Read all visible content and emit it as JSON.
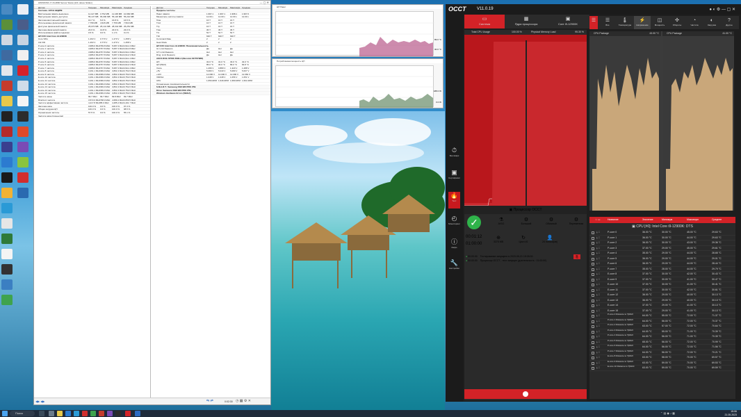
{
  "hwinfo": {
    "title": "HWiNFO64 v7.16-4800 Sensor Status [121 values hidden]",
    "left_cols": [
      "Датчик",
      "Текущее",
      "Минимум",
      "Максимум",
      "Среднее"
    ],
    "right_cols": [
      "Датчик",
      "Текущее",
      "Минимум",
      "Максимум",
      "Среднее"
    ],
    "left_rows": [
      {
        "n": "Системн. АРСН НКДРМ",
        "c": "",
        "mn": "",
        "mx": "",
        "av": "",
        "g": true
      },
      {
        "n": "Виртуальная память выделено",
        "c": "11,127 MB",
        "mn": "3,752 MB",
        "mx": "11,168 MB",
        "av": "10,984 MB"
      },
      {
        "n": "Виртуальная память доступно",
        "c": "55,147 MB",
        "mn": "65,090 MB",
        "mx": "55,118 MB",
        "av": "55,210 MB"
      },
      {
        "n": "Загрузка виртуальной памяти",
        "c": "16.7 %",
        "mn": "5.6 %",
        "mx": "16.8 %",
        "av": "16.5 %"
      },
      {
        "n": "Использовано физической памяти",
        "c": "7,758 MB",
        "mn": "4,526 MB",
        "mx": "7,756 MB",
        "av": "7,563 MB"
      },
      {
        "n": "Доступно физической памяти",
        "c": "25,073 MB",
        "mn": "25,141 MB",
        "mx": "28,344 MB",
        "av": "25,251 MB"
      },
      {
        "n": "Загрузка физической памяти",
        "c": "23.6 %",
        "mn": "13.8 %",
        "mx": "23.9 %",
        "av": "23.0 %"
      },
      {
        "n": "Использование файла подкачки",
        "c": "0.5 %",
        "mn": "0.0 %",
        "mx": "1.1 %",
        "av": "0.4 %"
      },
      {
        "n": "ЦП [#0]: Intel Core i9-12900K",
        "c": "",
        "mn": "",
        "mx": "",
        "av": "",
        "g": true
      },
      {
        "n": "Core VIDs",
        "c": "1.263 V",
        "mn": "0.770 V",
        "mx": "1.270 V",
        "av": "1.258 V"
      },
      {
        "n": "Clk VID",
        "c": "1.263 V",
        "mn": "0.770 V",
        "mx": "1.270 V",
        "av": "1.258 V"
      },
      {
        "n": "P-core 0 частота",
        "c": "4,986.0 MHz",
        "mn": "799.8 MHz",
        "mx": "5,087.3 MHz",
        "av": "4,911.3 MHz"
      },
      {
        "n": "P-core 1 частота",
        "c": "4,986.0 MHz",
        "mn": "797.8 MHz",
        "mx": "5,087.3 MHz",
        "av": "4,911.8 MHz"
      },
      {
        "n": "P-core 2 частота",
        "c": "4,986.0 MHz",
        "mn": "797.8 MHz",
        "mx": "5,087.3 MHz",
        "av": "4,911.3 MHz"
      },
      {
        "n": "P-core 3 частота",
        "c": "4,986.0 MHz",
        "mn": "797.8 MHz",
        "mx": "5,087.3 MHz",
        "av": "4,912.3 MHz"
      },
      {
        "n": "P-core 4 частота",
        "c": "4,986.0 MHz",
        "mn": "797.8 MHz",
        "mx": "5,087.3 MHz",
        "av": "4,911.4 MHz"
      },
      {
        "n": "P-core 5 частота",
        "c": "4,986.0 MHz",
        "mn": "797.8 MHz",
        "mx": "5,087.3 MHz",
        "av": "4,911.4 MHz"
      },
      {
        "n": "P-core 6 частота",
        "c": "4,986.0 MHz",
        "mn": "797.8 MHz",
        "mx": "5,087.3 MHz",
        "av": "4,912.3 MHz"
      },
      {
        "n": "P-core 7 частота",
        "c": "4,986.0 MHz",
        "mn": "797.8 MHz",
        "mx": "5,087.3 MHz",
        "av": "4,911.4 MHz"
      },
      {
        "n": "E-core 8 частота",
        "c": "3,461.1 MHz",
        "mn": "399.9 MHz",
        "mx": "3,891.9 MHz",
        "av": "3,752.6 MHz"
      },
      {
        "n": "E-core 9 частота",
        "c": "3,461.1 MHz",
        "mn": "399.9 MHz",
        "mx": "3,891.9 MHz",
        "av": "3,752.6 MHz"
      },
      {
        "n": "E-core 10 частота",
        "c": "3,461.1 MHz",
        "mn": "399.9 MHz",
        "mx": "3,891.9 MHz",
        "av": "3,752.6 MHz"
      },
      {
        "n": "E-core 11 частота",
        "c": "3,461.1 MHz",
        "mn": "399.9 MHz",
        "mx": "3,891.9 MHz",
        "av": "3,752.6 MHz"
      },
      {
        "n": "E-core 12 частота",
        "c": "3,461.1 MHz",
        "mn": "399.9 MHz",
        "mx": "3,891.9 MHz",
        "av": "3,752.6 MHz"
      },
      {
        "n": "E-core 13 частота",
        "c": "3,461.1 MHz",
        "mn": "399.9 MHz",
        "mx": "3,891.9 MHz",
        "av": "3,752.6 MHz"
      },
      {
        "n": "E-core 14 частота",
        "c": "3,461.1 MHz",
        "mn": "399.9 MHz",
        "mx": "3,891.9 MHz",
        "av": "3,752.6 MHz"
      },
      {
        "n": "E-core 15 частота",
        "c": "3,461.1 MHz",
        "mn": "399.9 MHz",
        "mx": "3,891.9 MHz",
        "av": "3,752.6 MHz"
      },
      {
        "n": "Частота шины",
        "c": "99.7 MHz",
        "mn": "99.7 MHz",
        "mx": "99.8 MHz",
        "av": "99.7 MHz"
      },
      {
        "n": "Ring/LLC частота",
        "c": "3,572.0 MHz",
        "mn": "798.0 MHz",
        "mx": "4,689.4 MHz",
        "av": "3,650.5 MHz"
      },
      {
        "n": "Частота эффективная частота",
        "c": "4,217.8 MHz",
        "mn": "85.0 MHz",
        "mx": "4,285.4 MHz",
        "av": "4,191.7 MHz"
      },
      {
        "n": "Загрузка ядра",
        "c": "100.0 %",
        "mn": "0.0 %",
        "mx": "100.0 %",
        "av": "97.3 %"
      },
      {
        "n": "Общая загрузка ЦП",
        "c": "100.0 %",
        "mn": "0.6 %",
        "mx": "100.0 %",
        "av": "98.5 %"
      },
      {
        "n": "Ограничения частоты",
        "c": "57.5 %",
        "mn": "0.0 %",
        "mx": "100.0 %",
        "av": "55.1 %"
      },
      {
        "n": "Частота ядра (процентов)",
        "c": "",
        "mn": "",
        "mx": "",
        "av": ""
      }
    ],
    "right_rows": [
      {
        "n": "Пределы частоты",
        "c": "",
        "mn": "",
        "mx": "",
        "av": "",
        "g": true
      },
      {
        "n": "Пакет памяти",
        "c": "1,997.1",
        "mn": "1,997.1",
        "mx": "1,998.1",
        "av": "1,997.6"
      },
      {
        "n": "Множитель частоты памяти",
        "c": "12.00 x",
        "mn": "12.00 x",
        "mx": "12.00 x",
        "av": "12.00 x"
      },
      {
        "n": "Tcas",
        "c": "16 T",
        "mn": "16 T",
        "mx": "16 T",
        "av": ""
      },
      {
        "n": "Trcd",
        "c": "16 T",
        "mn": "16 T",
        "mx": "16 T",
        "av": ""
      },
      {
        "n": "Trp",
        "c": "16 T",
        "mn": "16 T",
        "mx": "16 T",
        "av": ""
      },
      {
        "n": "Tras",
        "c": "36 T",
        "mn": "36 T",
        "mx": "36 T",
        "av": ""
      },
      {
        "n": "Trc",
        "c": "52 T",
        "mn": "52 T",
        "mx": "52 T",
        "av": ""
      },
      {
        "n": "Trfc",
        "c": "630 T",
        "mn": "630 T",
        "mx": "630 T",
        "av": ""
      },
      {
        "n": "Command Rate",
        "c": "2",
        "mn": "2",
        "mx": "2",
        "av": ""
      },
      {
        "n": "Gear Mode",
        "c": "2",
        "mn": "2",
        "mx": "2",
        "av": ""
      },
      {
        "n": "ЦП [#0]: Intel Core i9-12900K: Производительность",
        "c": "",
        "mn": "",
        "mx": "",
        "av": "",
        "g": true
      },
      {
        "n": "IA: Limit Reasons",
        "c": "Да",
        "mn": "Нет",
        "mx": "Да",
        "av": ""
      },
      {
        "n": "GT: Limit Reasons",
        "c": "Нет",
        "mn": "Нет",
        "mx": "Нет",
        "av": ""
      },
      {
        "n": "Ring: Limit Reasons",
        "c": "Да",
        "mn": "Нет",
        "mx": "Да",
        "av": ""
      },
      {
        "n": "ASUS ROG STRIX Z690-A (Nuvoton NCT6798D)",
        "c": "",
        "mn": "",
        "mx": "",
        "av": "",
        "g": true
      },
      {
        "n": "ЦП",
        "c": "32.0 °C",
        "mn": "31.0 °C",
        "mx": "33.0 °C",
        "av": "32.0 °C"
      },
      {
        "n": "ЦП (PECI)",
        "c": "85.0 °C",
        "mn": "30.0 °C",
        "mx": "89.0 °C",
        "av": "83.8 °C"
      },
      {
        "n": "Vcore",
        "c": "1.296 V",
        "mn": "0.880 V",
        "mx": "1.320 V",
        "av": "1.288 V"
      },
      {
        "n": "+5V",
        "c": "5.080 V",
        "mn": "5.040 V",
        "mx": "5.080 V",
        "av": "5.067 V"
      },
      {
        "n": "+12V",
        "c": "12.096 V",
        "mn": "12.000 V",
        "mx": "12.096 V",
        "av": "12.060 V"
      },
      {
        "n": "VDDSA",
        "c": "1.048 V",
        "mn": "1.048 V",
        "mx": "1.056 V",
        "av": "1.051 V"
      },
      {
        "n": "CPU",
        "c": "1,556 RPM",
        "mn": "1,546 RPM",
        "mx": "1,580 RPM",
        "av": "1,561 RPM"
      },
      {
        "n": "Ограничение производительности",
        "c": "",
        "mn": "",
        "mx": "",
        "av": ""
      },
      {
        "n": "S.M.A.R.T.: Samsung SSD 980 PRO 2TB",
        "c": "",
        "mn": "",
        "mx": "",
        "av": "",
        "g": true
      },
      {
        "n": "Drive: Samsung SSD 980 PRO 2TB",
        "c": "",
        "mn": "",
        "mx": "",
        "av": "",
        "g": true
      },
      {
        "n": "Windows Hardware Errors (WHEA)",
        "c": "",
        "mn": "",
        "mx": "",
        "av": "",
        "g": true
      }
    ],
    "status_time": "0:02:30"
  },
  "graph_windows": {
    "top_title": "ЦП Пакет",
    "bottom_title": "Потребляемая мощность ЦП",
    "top_max": "89.0 °C",
    "top_min": "30.0 °C",
    "bottom_max": "188.0 W",
    "bottom_min": "0.0 W"
  },
  "occt": {
    "logo": "OCCT",
    "version": "V11.0.19",
    "top_tabs": [
      "Система",
      "Ядра процессора",
      "Core i9-12900K"
    ],
    "left_panel": {
      "h1": "Total CPU Usage",
      "v1": "100.00 %",
      "h2": "Physical Memory Load",
      "v2": "95.30 %"
    },
    "side": [
      {
        "icon": "⏱",
        "label": "Бенчмарк"
      },
      {
        "icon": "▣",
        "label": "Сертификат"
      },
      {
        "icon": "🔥",
        "label": "Тест"
      },
      {
        "icon": "◴",
        "label": "Мониторинг"
      },
      {
        "icon": "ⓘ",
        "label": "Инфо"
      },
      {
        "icon": "🔧",
        "label": "Настройки"
      }
    ],
    "test": {
      "title": "Процессор OCCT",
      "modes": [
        "AVX2",
        "Большой",
        "Обычный",
        "Переменная"
      ],
      "elapsed": "00:01:12",
      "duration": "01:00:00",
      "stat1": "3375 MB",
      "stat2": "Цикл #1",
      "stat3": "24 потока(ов)",
      "log": [
        {
          "t": "00:00:00",
          "m": "Тестирование запущено в 2023-05-21 15:05:00"
        },
        {
          "t": "00:00:00",
          "m": "Процессор OCCT - тест запущен (длительность : 01:00:00)"
        }
      ]
    },
    "perf_tabs": [
      {
        "icon": "☰",
        "label": "Все"
      },
      {
        "icon": "🌡",
        "label": "Температура"
      },
      {
        "icon": "⚡",
        "label": "Напряжение"
      },
      {
        "icon": "◫",
        "label": "Мощность"
      },
      {
        "icon": "✣",
        "label": "Обороты"
      },
      {
        "icon": "◔",
        "label": "Частота"
      },
      {
        "icon": "◐",
        "label": "Загрузка"
      },
      {
        "icon": "?",
        "label": "Другое"
      }
    ],
    "perf_panels": [
      {
        "title": "CPU Package",
        "value": "43.00 °C"
      },
      {
        "title": "CPU Package",
        "value": "41.00 °C"
      }
    ],
    "sensor_header": [
      "Название",
      "Значение",
      "Минимум",
      "Максимум",
      "Среднее"
    ],
    "sensor_group": "CPU [#0]: Intel Core i9-12900K: DTS",
    "sensors": [
      {
        "n": "P-core 0",
        "v": "36.00 °C",
        "mn": "30.00 °C",
        "mx": "45.00 °C",
        "av": "29.63 °C"
      },
      {
        "n": "P-core 1",
        "v": "36.00 °C",
        "mn": "30.00 °C",
        "mx": "44.00 °C",
        "av": "29.63 °C"
      },
      {
        "n": "P-core 2",
        "v": "36.00 °C",
        "mn": "30.00 °C",
        "mx": "43.00 °C",
        "av": "29.36 °C"
      },
      {
        "n": "P-core 3",
        "v": "37.00 °C",
        "mn": "29.00 °C",
        "mx": "45.00 °C",
        "av": "29.61 °C"
      },
      {
        "n": "P-core 4",
        "v": "35.00 °C",
        "mn": "29.00 °C",
        "mx": "44.00 °C",
        "av": "28.65 °C"
      },
      {
        "n": "P-core 5",
        "v": "36.00 °C",
        "mn": "29.00 °C",
        "mx": "44.00 °C",
        "av": "29.01 °C"
      },
      {
        "n": "P-core 6",
        "v": "36.00 °C",
        "mn": "29.00 °C",
        "mx": "44.00 °C",
        "av": "28.44 °C"
      },
      {
        "n": "P-core 7",
        "v": "35.00 °C",
        "mn": "28.00 °C",
        "mx": "44.00 °C",
        "av": "29.79 °C"
      },
      {
        "n": "E-core 8",
        "v": "37.00 °C",
        "mn": "30.00 °C",
        "mx": "42.00 °C",
        "av": "30.43 °C"
      },
      {
        "n": "E-core 9",
        "v": "37.00 °C",
        "mn": "30.00 °C",
        "mx": "41.00 °C",
        "av": "30.47 °C"
      },
      {
        "n": "E-core 10",
        "v": "37.00 °C",
        "mn": "30.00 °C",
        "mx": "41.00 °C",
        "av": "30.41 °C"
      },
      {
        "n": "E-core 11",
        "v": "37.00 °C",
        "mn": "30.00 °C",
        "mx": "42.00 °C",
        "av": "30.61 °C"
      },
      {
        "n": "E-core 12",
        "v": "36.00 °C",
        "mn": "29.00 °C",
        "mx": "40.00 °C",
        "av": "30.13 °C"
      },
      {
        "n": "E-core 13",
        "v": "36.00 °C",
        "mn": "29.00 °C",
        "mx": "40.00 °C",
        "av": "30.13 °C"
      },
      {
        "n": "E-core 14",
        "v": "37.00 °C",
        "mn": "29.00 °C",
        "mx": "41.00 °C",
        "av": "30.13 °C"
      },
      {
        "n": "E-core 15",
        "v": "37.00 °C",
        "mn": "29.00 °C",
        "mx": "41.00 °C",
        "av": "30.13 °C"
      },
      {
        "n": "P-core 0 Distance to TjMAX",
        "v": "64.00 °C",
        "mn": "55.00 °C",
        "mx": "72.00 °C",
        "av": "71.37 °C"
      },
      {
        "n": "P-core 1 Distance to TjMAX",
        "v": "64.00 °C",
        "mn": "56.00 °C",
        "mx": "72.00 °C",
        "av": "70.37 °C"
      },
      {
        "n": "P-core 2 Distance to TjMAX",
        "v": "63.00 °C",
        "mn": "57.00 °C",
        "mx": "72.00 °C",
        "av": "70.64 °C"
      },
      {
        "n": "P-core 3 Distance to TjMAX",
        "v": "64.00 °C",
        "mn": "55.00 °C",
        "mx": "71.00 °C",
        "av": "70.39 °C"
      },
      {
        "n": "P-core 4 Distance to TjMAX",
        "v": "64.00 °C",
        "mn": "56.00 °C",
        "mx": "71.00 °C",
        "av": "70.39 °C"
      },
      {
        "n": "P-core 5 Distance to TjMAX",
        "v": "65.00 °C",
        "mn": "56.00 °C",
        "mx": "72.00 °C",
        "av": "70.99 °C"
      },
      {
        "n": "P-core 6 Distance to TjMAX",
        "v": "64.00 °C",
        "mn": "56.00 °C",
        "mx": "72.00 °C",
        "av": "71.56 °C"
      },
      {
        "n": "P-core 7 Distance to TjMAX",
        "v": "64.00 °C",
        "mn": "56.00 °C",
        "mx": "72.00 °C",
        "av": "70.21 °C"
      },
      {
        "n": "E-core 8 Distance to TjMAX",
        "v": "63.00 °C",
        "mn": "58.00 °C",
        "mx": "70.00 °C",
        "av": "69.57 °C"
      },
      {
        "n": "E-core 9 Distance to TjMAX",
        "v": "63.00 °C",
        "mn": "59.00 °C",
        "mx": "70.00 °C",
        "av": "69.53 °C"
      },
      {
        "n": "E-core 10 Distance to TjMAX",
        "v": "63.00 °C",
        "mn": "59.00 °C",
        "mx": "70.00 °C",
        "av": "69.59 °C"
      }
    ]
  },
  "taskbar": {
    "search": "Поиск",
    "time": "15:06",
    "date": "21.05.2023"
  },
  "colors": {
    "occt_red": "#d32227",
    "occt_bg": "#1e1e1e",
    "graph_fill": "#c9a77a"
  }
}
